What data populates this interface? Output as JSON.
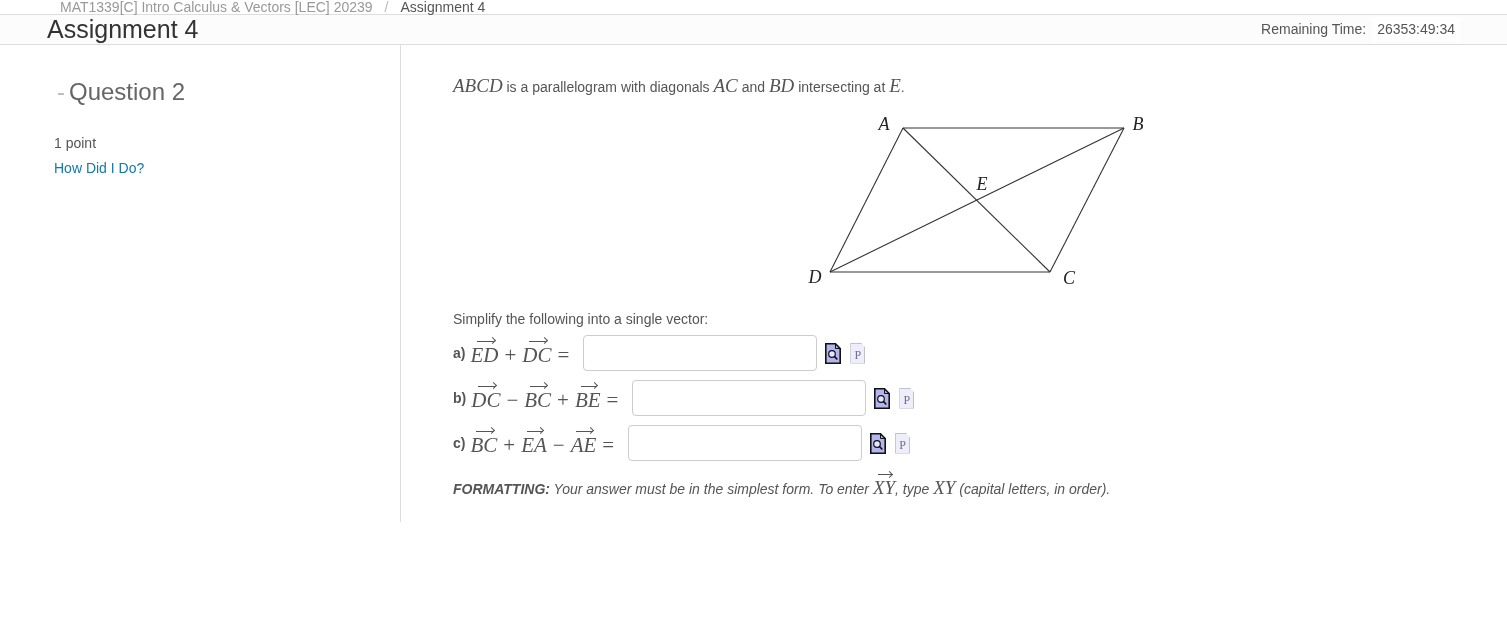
{
  "breadcrumb": {
    "separator": "/",
    "items": [
      {
        "text": "MAT1339[C] Intro Calculus & Vectors [LEC] 20239",
        "current": false
      },
      {
        "text": "Assignment 4",
        "current": true
      }
    ]
  },
  "header": {
    "title": "Assignment 4",
    "timer_label": "Remaining Time:",
    "timer_value": "26353:49:34"
  },
  "sidebar": {
    "collapse_symbol": "-",
    "question_title": "Question 2",
    "points": "1 point",
    "feedback_link": "How Did I Do?"
  },
  "question": {
    "intro": [
      {
        "kind": "math",
        "text": "ABCD"
      },
      {
        "kind": "text",
        "text": " is a parallelogram with diagonals "
      },
      {
        "kind": "math",
        "text": "AC"
      },
      {
        "kind": "text",
        "text": " and "
      },
      {
        "kind": "math",
        "text": "BD"
      },
      {
        "kind": "text",
        "text": " intersecting at "
      },
      {
        "kind": "math",
        "text": "E"
      },
      {
        "kind": "text",
        "text": "."
      }
    ],
    "diagram": {
      "labels": [
        "A",
        "B",
        "C",
        "D",
        "E"
      ]
    },
    "instruction": "Simplify the following into a single vector:",
    "parts": [
      {
        "label": "a)",
        "terms": [
          {
            "kind": "vector",
            "text": "ED"
          },
          {
            "kind": "operator",
            "text": "+"
          },
          {
            "kind": "vector",
            "text": "DC"
          },
          {
            "kind": "operator",
            "text": "="
          }
        ],
        "tools": [
          {
            "kind": "preview",
            "disabled": false
          },
          {
            "kind": "letter",
            "text": "P",
            "disabled": true
          }
        ]
      },
      {
        "label": "b)",
        "terms": [
          {
            "kind": "vector",
            "text": "DC"
          },
          {
            "kind": "operator",
            "text": "−"
          },
          {
            "kind": "vector",
            "text": "BC"
          },
          {
            "kind": "operator",
            "text": "+"
          },
          {
            "kind": "vector",
            "text": "BE"
          },
          {
            "kind": "operator",
            "text": "="
          }
        ],
        "tools": [
          {
            "kind": "preview",
            "disabled": false
          },
          {
            "kind": "letter",
            "text": "P",
            "disabled": true
          }
        ]
      },
      {
        "label": "c)",
        "terms": [
          {
            "kind": "vector",
            "text": "BC"
          },
          {
            "kind": "operator",
            "text": "+"
          },
          {
            "kind": "vector",
            "text": "EA"
          },
          {
            "kind": "operator",
            "text": "−"
          },
          {
            "kind": "vector",
            "text": "AE"
          },
          {
            "kind": "operator",
            "text": "="
          }
        ],
        "tools": [
          {
            "kind": "preview",
            "disabled": false
          },
          {
            "kind": "letter",
            "text": "P",
            "disabled": true
          }
        ]
      }
    ],
    "formatting": [
      {
        "kind": "text",
        "text": "**FORMATTING:** Your answer must be in the simplest form. To enter "
      },
      {
        "kind": "vector",
        "text": "XY"
      },
      {
        "kind": "text",
        "text": ", type "
      },
      {
        "kind": "math",
        "text": "XY"
      },
      {
        "kind": "text",
        "text": " (capital letters, in order)."
      }
    ]
  }
}
